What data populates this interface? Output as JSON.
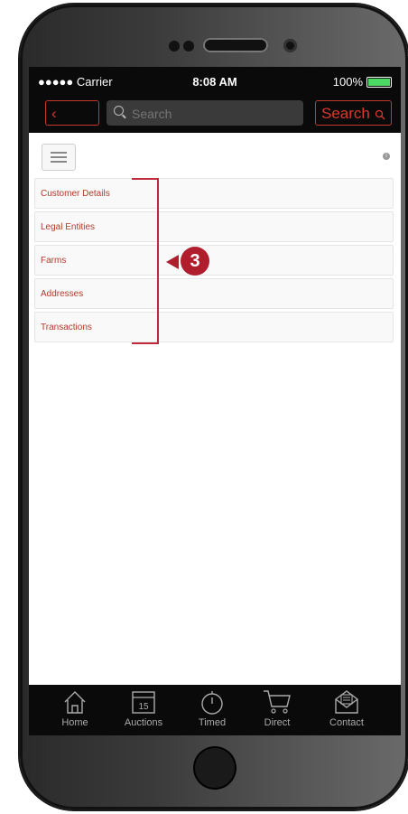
{
  "status_bar": {
    "carrier": "●●●●● Carrier",
    "time": "8:08 AM",
    "battery": "100%"
  },
  "nav": {
    "back_label": "‹ Back",
    "search_placeholder": "Search",
    "search_button_label": "Search"
  },
  "menu": {
    "items": [
      {
        "label": "Customer Details"
      },
      {
        "label": "Legal Entities"
      },
      {
        "label": "Farms"
      },
      {
        "label": "Addresses"
      },
      {
        "label": "Transactions"
      }
    ]
  },
  "annotation": {
    "step_number": "3"
  },
  "tabbar": {
    "tabs": [
      {
        "label": "Home",
        "icon": "home-icon"
      },
      {
        "label": "Auctions",
        "icon": "calendar-icon",
        "calendar_day": "15"
      },
      {
        "label": "Timed",
        "icon": "stopwatch-icon"
      },
      {
        "label": "Direct",
        "icon": "cart-icon"
      },
      {
        "label": "Contact",
        "icon": "mail-icon"
      }
    ]
  },
  "colors": {
    "accent": "#d9382c",
    "annotation": "#b01e2e",
    "bar_background": "#0a0a0a"
  }
}
